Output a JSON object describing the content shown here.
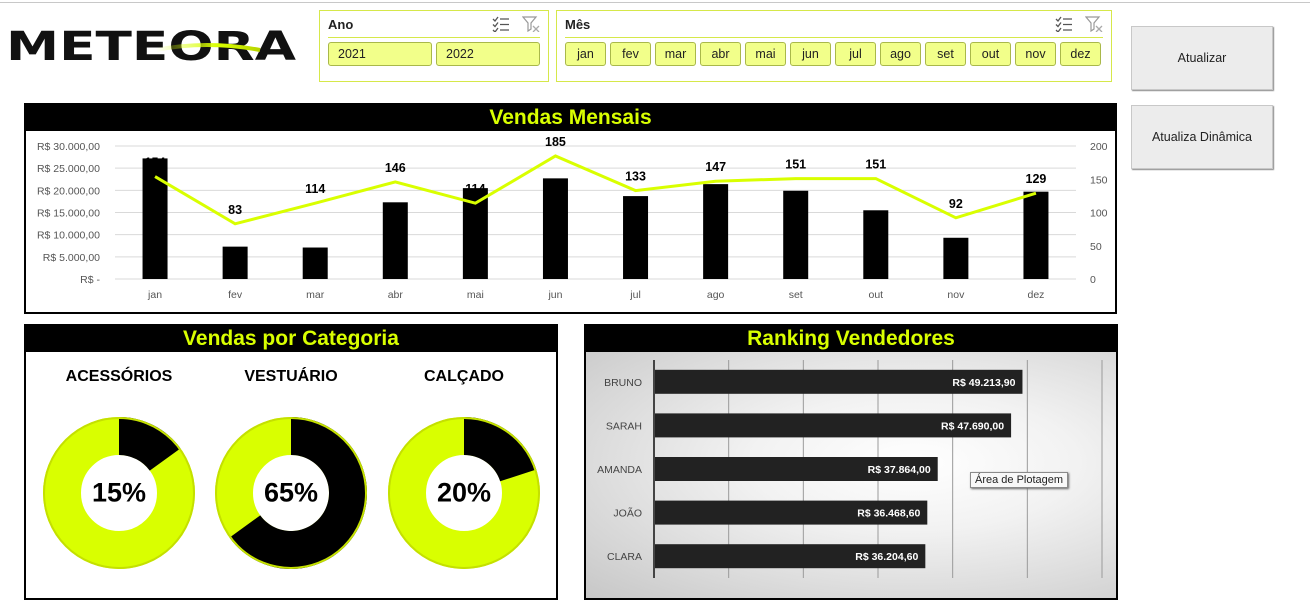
{
  "brand": {
    "logo_text": "METEORA",
    "accent": "#d9ff00",
    "dark": "#000000"
  },
  "slicers": {
    "year": {
      "title": "Ano",
      "options": [
        "2021",
        "2022"
      ]
    },
    "month": {
      "title": "Mês",
      "options": [
        "jan",
        "fev",
        "mar",
        "abr",
        "mai",
        "jun",
        "jul",
        "ago",
        "set",
        "out",
        "nov",
        "dez"
      ]
    },
    "icons": [
      "multi-select-icon",
      "clear-filter-icon"
    ]
  },
  "buttons": {
    "update": "Atualizar",
    "update_dynamic": "Atualiza Dinâmica"
  },
  "monthly": {
    "title": "Vendas Mensais",
    "chart_data": {
      "type": "bar",
      "categories": [
        "jan",
        "fev",
        "mar",
        "abr",
        "mai",
        "jun",
        "jul",
        "ago",
        "set",
        "out",
        "nov",
        "dez"
      ],
      "series": [
        {
          "type": "bar",
          "axis": "left",
          "values": [
            27200,
            7300,
            7100,
            17300,
            20500,
            22700,
            18700,
            21400,
            19900,
            15500,
            9300,
            19700
          ]
        },
        {
          "type": "line",
          "axis": "right",
          "values": [
            154,
            83,
            114,
            146,
            114,
            185,
            133,
            147,
            151,
            151,
            92,
            129
          ]
        }
      ],
      "y_left": {
        "range": [
          0,
          30000
        ],
        "ticks": [
          "R$ -",
          "R$ 5.000,00",
          "R$ 10.000,00",
          "R$ 15.000,00",
          "R$ 20.000,00",
          "R$ 25.000,00",
          "R$ 30.000,00"
        ]
      },
      "y_right": {
        "range": [
          0,
          200
        ],
        "ticks": [
          "0",
          "50",
          "100",
          "150",
          "200"
        ]
      },
      "grid": true,
      "bar_color": "#000000",
      "line_color": "#d9ff00"
    }
  },
  "category": {
    "title": "Vendas por Categoria",
    "chart_data": {
      "type": "pie",
      "categories": [
        "ACESSÓRIOS",
        "VESTUÁRIO",
        "CALÇADO"
      ],
      "values": [
        15,
        65,
        20
      ],
      "labels": [
        "15%",
        "65%",
        "20%"
      ],
      "fill_color": "#000000",
      "rest_color": "#d9ff00"
    }
  },
  "ranking": {
    "title": "Ranking Vendedores",
    "tooltip": "Área de Plotagem",
    "chart_data": {
      "type": "bar",
      "orientation": "horizontal",
      "categories": [
        "BRUNO",
        "SARAH",
        "AMANDA",
        "JOÃO",
        "CLARA"
      ],
      "values": [
        49213.9,
        47690.0,
        37864.0,
        36468.6,
        36204.6
      ],
      "labels": [
        "R$ 49.213,90",
        "R$ 47.690,00",
        "R$ 37.864,00",
        "R$ 36.468,60",
        "R$ 36.204,60"
      ],
      "xlim": [
        0,
        60000
      ],
      "grid": true
    }
  }
}
